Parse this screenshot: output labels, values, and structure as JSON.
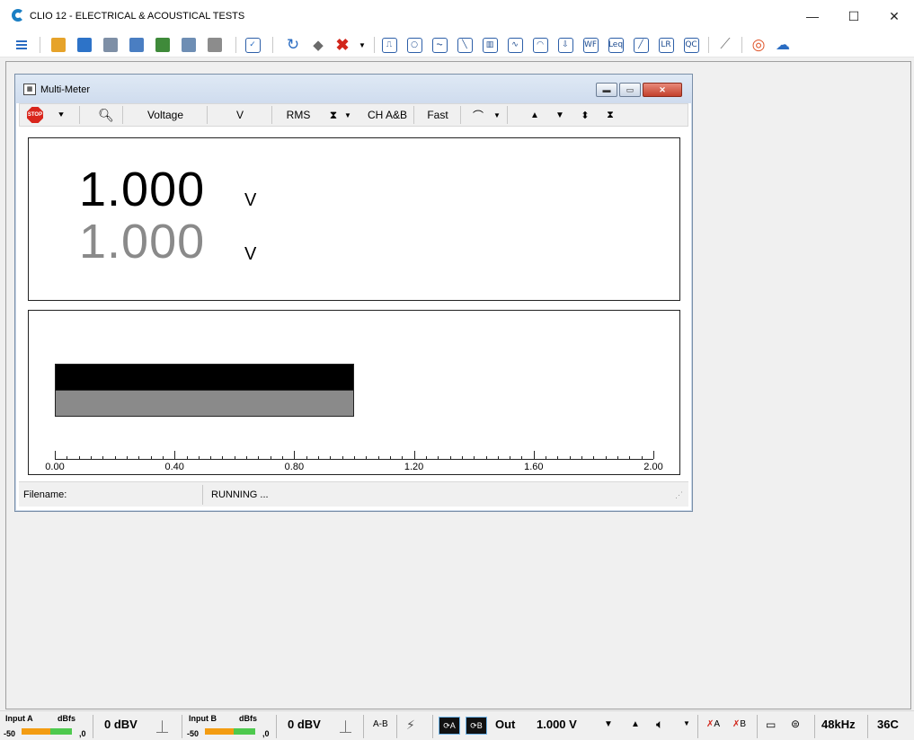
{
  "app": {
    "title": "CLIO 12 - ELECTRICAL & ACOUSTICAL TESTS",
    "window_buttons": {
      "minimize": "—",
      "maximize": "☐",
      "close": "✕"
    }
  },
  "toolbar": {
    "icons": [
      "menu-icon",
      "open-icon",
      "save-icon",
      "settings-icon",
      "edit-icon",
      "image-icon",
      "clapper-icon",
      "print-icon",
      "check-icon",
      "refresh-icon",
      "eraser-icon",
      "delete-icon",
      "pulse-icon",
      "circle-icon",
      "wave-icon",
      "slope-icon",
      "bars-icon",
      "sine-icon",
      "polar-icon",
      "level-icon",
      "wf-icon",
      "leq-icon",
      "line-icon",
      "lr-icon",
      "qc-icon",
      "ruler-icon",
      "lifebuoy-icon",
      "cloud-help-icon"
    ],
    "labels": {
      "wf": "WF",
      "leq": "Leq",
      "lr": "LR",
      "qc": "QC"
    }
  },
  "multimeter": {
    "title": "Multi-Meter",
    "toolbar": {
      "stop": "STOP",
      "quantity": "Voltage",
      "unit": "V",
      "mode": "RMS",
      "channel": "CH A&B",
      "speed": "Fast"
    },
    "readings": [
      {
        "value": "1.000",
        "unit": "V",
        "color": "#000000"
      },
      {
        "value": "1.000",
        "unit": "V",
        "color": "#8a8a8a"
      }
    ],
    "bars": [
      {
        "fraction": 0.5,
        "color": "#000000"
      },
      {
        "fraction": 0.5,
        "color": "#8a8a8a"
      }
    ],
    "scale": {
      "min": 0.0,
      "max": 2.0,
      "labels": [
        "0.00",
        "0.40",
        "0.80",
        "1.20",
        "1.60",
        "2.00"
      ]
    },
    "status": {
      "filename_label": "Filename:",
      "state": "RUNNING ..."
    }
  },
  "statusbar": {
    "input_a": {
      "label": "Input A",
      "unit": "dBfs",
      "min": "-50",
      "max": ",0",
      "level": "0 dBV"
    },
    "input_b": {
      "label": "Input B",
      "unit": "dBfs",
      "min": "-50",
      "max": ",0",
      "level": "0 dBV"
    },
    "ab_label": "A-B",
    "ch_a": "A",
    "ch_b": "B",
    "out_label": "Out",
    "out_level": "1.000 V",
    "gen_a": "A",
    "gen_b": "B",
    "sample_rate": "48kHz",
    "temperature": "36C"
  }
}
